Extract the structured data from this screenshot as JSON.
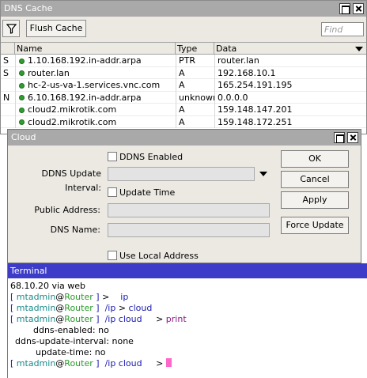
{
  "dns_cache": {
    "title": "DNS Cache",
    "flush_label": "Flush Cache",
    "find_placeholder": "Find",
    "columns": [
      "Name",
      "Type",
      "Data"
    ],
    "rows": [
      {
        "flag": "S",
        "name": "1.10.168.192.in-addr.arpa",
        "type": "PTR",
        "data": "router.lan"
      },
      {
        "flag": "S",
        "name": "router.lan",
        "type": "A",
        "data": "192.168.10.1"
      },
      {
        "flag": "",
        "name": "hc-2-us-va-1.services.vnc.com",
        "type": "A",
        "data": "165.254.191.195"
      },
      {
        "flag": "N",
        "name": "6.10.168.192.in-addr.arpa",
        "type": "unknown",
        "data": "0.0.0.0"
      },
      {
        "flag": "",
        "name": "cloud2.mikrotik.com",
        "type": "A",
        "data": "159.148.147.201"
      },
      {
        "flag": "",
        "name": "cloud2.mikrotik.com",
        "type": "A",
        "data": "159.148.172.251"
      }
    ]
  },
  "cloud": {
    "title": "Cloud",
    "ddns_enabled_label": "DDNS Enabled",
    "ddns_update_interval_label": "DDNS Update Interval:",
    "update_time_label": "Update Time",
    "public_address_label": "Public Address:",
    "dns_name_label": "DNS Name:",
    "use_local_address_label": "Use Local Address",
    "ok_label": "OK",
    "cancel_label": "Cancel",
    "apply_label": "Apply",
    "force_update_label": "Force Update"
  },
  "terminal": {
    "title": "Terminal",
    "line1": "68.10.20 via web",
    "user": "mtadmin",
    "at": "@",
    "host": "Router",
    "open_bracket": "[",
    "close_bracket": "]",
    "gt": ">",
    "cmd_ip": "ip",
    "path_ip": "/ip",
    "cmd_cloud": "cloud",
    "path_ip_cloud": "/ip cloud",
    "cmd_print": "print",
    "out1": "ddns-enabled: no",
    "out2": "ddns-update-interval: none",
    "out3": "update-time: no"
  }
}
